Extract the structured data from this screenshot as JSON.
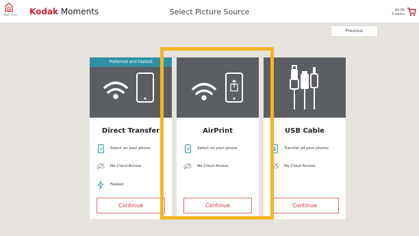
{
  "header": {
    "home_label": "Start Over",
    "brand_bold": "Kodak",
    "brand_rest": " Moments",
    "title": "Select Picture Source",
    "cart_amount": "$0.00",
    "cart_items": "0 items"
  },
  "nav": {
    "previous_label": "Previous"
  },
  "colors": {
    "brand_red": "#cf2030",
    "badge": "#2f8fa3",
    "highlight": "#f5b523",
    "card_image_bg": "#5b5e63"
  },
  "cards": [
    {
      "badge": "Preferred and Fastest",
      "title": "Direct Transfer",
      "image_icons": [
        "wifi-icon",
        "phone-icon"
      ],
      "features": [
        {
          "icon": "phone-check-icon",
          "text": "Select on your phone"
        },
        {
          "icon": "no-cloud-icon",
          "text": "No Cloud Access"
        },
        {
          "icon": "lightning-icon",
          "text": "Fastest"
        }
      ],
      "button": "Continue"
    },
    {
      "title": "AirPrint",
      "image_icons": [
        "wifi-icon",
        "phone-share-icon"
      ],
      "features": [
        {
          "icon": "phone-check-icon",
          "text": "Select on your phone"
        },
        {
          "icon": "no-cloud-icon",
          "text": "No Cloud Access"
        }
      ],
      "button": "Continue"
    },
    {
      "title": "USB Cable",
      "image_icons": [
        "usb-cable-icon"
      ],
      "features": [
        {
          "icon": "phone-transfer-icon",
          "text": "Transfer all your photos"
        },
        {
          "icon": "no-cloud-icon",
          "text": "No Cloud Access"
        }
      ],
      "button": "Continue"
    }
  ]
}
